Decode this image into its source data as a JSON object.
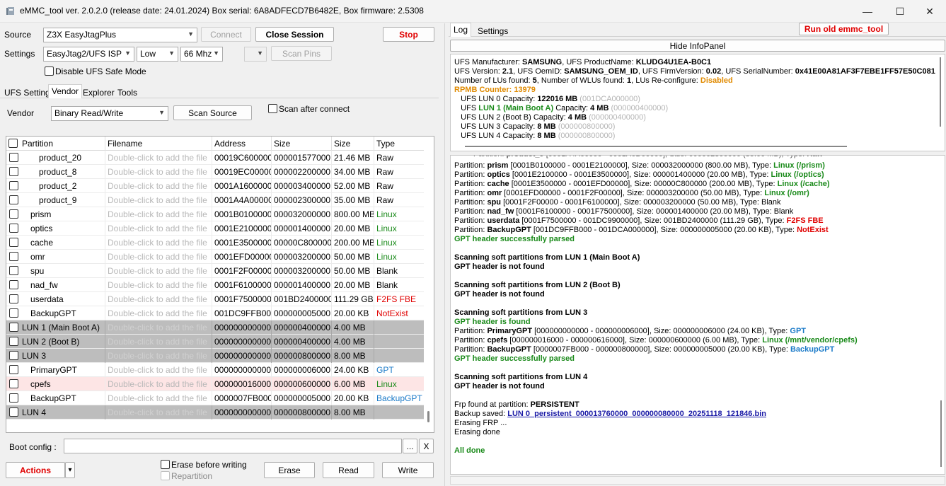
{
  "window": {
    "title": "eMMC_tool ver. 2.0.2.0 (release date: 24.01.2024) Box serial: 6A8ADFECD7B6482E, Box firmware: 2.5308",
    "minimize": "—",
    "maximize": "☐",
    "close": "✕"
  },
  "source": {
    "label": "Source",
    "value": "Z3X EasyJtagPlus",
    "connect": "Connect",
    "close_session": "Close Session",
    "stop": "Stop"
  },
  "settings": {
    "label": "Settings",
    "interface": "EasyJtag2/UFS ISP",
    "level": "Low",
    "speed": "66 Mhz",
    "extra": "",
    "scan_pins": "Scan Pins",
    "disable_safe_mode": "Disable UFS Safe Mode"
  },
  "left_tabs": [
    "UFS Settings",
    "Vendor",
    "Explorer",
    "Tools"
  ],
  "vendor": {
    "label": "Vendor",
    "value": "Binary Read/Write",
    "scan_source": "Scan Source",
    "scan_after_connect": "Scan after connect"
  },
  "table": {
    "headers": [
      "Partition",
      "Filename",
      "Address",
      "Size",
      "Size",
      "Type"
    ],
    "rows": [
      {
        "partition": "product_20",
        "filename": "Double-click to add the file",
        "address": "00019C600000",
        "size_hex": "000001577000",
        "size": "21.46 MB",
        "type": "Raw",
        "kind": "part",
        "indent": 2,
        "tcolor": "#000000"
      },
      {
        "partition": "product_8",
        "filename": "Double-click to add the file",
        "address": "00019EC00000",
        "size_hex": "000002200000",
        "size": "34.00 MB",
        "type": "Raw",
        "kind": "part",
        "indent": 2,
        "tcolor": "#000000"
      },
      {
        "partition": "product_2",
        "filename": "Double-click to add the file",
        "address": "0001A1600000",
        "size_hex": "000003400000",
        "size": "52.00 MB",
        "type": "Raw",
        "kind": "part",
        "indent": 2,
        "tcolor": "#000000"
      },
      {
        "partition": "product_9",
        "filename": "Double-click to add the file",
        "address": "0001A4A00000",
        "size_hex": "000002300000",
        "size": "35.00 MB",
        "type": "Raw",
        "kind": "part",
        "indent": 2,
        "tcolor": "#000000"
      },
      {
        "partition": "prism",
        "filename": "Double-click to add the file",
        "address": "0001B0100000",
        "size_hex": "000032000000",
        "size": "800.00 MB",
        "type": "Linux",
        "kind": "part",
        "indent": 1,
        "tcolor": "#1a8a1a"
      },
      {
        "partition": "optics",
        "filename": "Double-click to add the file",
        "address": "0001E2100000",
        "size_hex": "000001400000",
        "size": "20.00 MB",
        "type": "Linux",
        "kind": "part",
        "indent": 1,
        "tcolor": "#1a8a1a"
      },
      {
        "partition": "cache",
        "filename": "Double-click to add the file",
        "address": "0001E3500000",
        "size_hex": "00000C800000",
        "size": "200.00 MB",
        "type": "Linux",
        "kind": "part",
        "indent": 1,
        "tcolor": "#1a8a1a"
      },
      {
        "partition": "omr",
        "filename": "Double-click to add the file",
        "address": "0001EFD00000",
        "size_hex": "000003200000",
        "size": "50.00 MB",
        "type": "Linux",
        "kind": "part",
        "indent": 1,
        "tcolor": "#1a8a1a"
      },
      {
        "partition": "spu",
        "filename": "Double-click to add the file",
        "address": "0001F2F00000",
        "size_hex": "000003200000",
        "size": "50.00 MB",
        "type": "Blank",
        "kind": "part",
        "indent": 1,
        "tcolor": "#000000"
      },
      {
        "partition": "nad_fw",
        "filename": "Double-click to add the file",
        "address": "0001F6100000",
        "size_hex": "000001400000",
        "size": "20.00 MB",
        "type": "Blank",
        "kind": "part",
        "indent": 1,
        "tcolor": "#000000"
      },
      {
        "partition": "userdata",
        "filename": "Double-click to add the file",
        "address": "0001F7500000",
        "size_hex": "001BD2400000",
        "size": "111.29 GB",
        "type": "F2FS FBE",
        "kind": "part",
        "indent": 1,
        "tcolor": "#e00000"
      },
      {
        "partition": "BackupGPT",
        "filename": "Double-click to add the file",
        "address": "001DC9FFB000",
        "size_hex": "000000005000",
        "size": "20.00 KB",
        "type": "NotExist",
        "kind": "part",
        "indent": 1,
        "tcolor": "#e00000"
      },
      {
        "partition": "LUN 1 (Main Boot A)",
        "filename": "Double-click to add the file",
        "address": "000000000000",
        "size_hex": "000000400000",
        "size": "4.00 MB",
        "type": "",
        "kind": "lun",
        "indent": 0,
        "tcolor": "#000000"
      },
      {
        "partition": "LUN 2 (Boot B)",
        "filename": "Double-click to add the file",
        "address": "000000000000",
        "size_hex": "000000400000",
        "size": "4.00 MB",
        "type": "",
        "kind": "lun",
        "indent": 0,
        "tcolor": "#000000"
      },
      {
        "partition": "LUN 3",
        "filename": "Double-click to add the file",
        "address": "000000000000",
        "size_hex": "000000800000",
        "size": "8.00 MB",
        "type": "",
        "kind": "lun",
        "indent": 0,
        "tcolor": "#000000"
      },
      {
        "partition": "PrimaryGPT",
        "filename": "Double-click to add the file",
        "address": "000000000000",
        "size_hex": "000000006000",
        "size": "24.00 KB",
        "type": "GPT",
        "kind": "part",
        "indent": 1,
        "tcolor": "#1a7ac8"
      },
      {
        "partition": "cpefs",
        "filename": "Double-click to add the file",
        "address": "000000016000",
        "size_hex": "000000600000",
        "size": "6.00 MB",
        "type": "Linux",
        "kind": "pink",
        "indent": 1,
        "tcolor": "#1a8a1a"
      },
      {
        "partition": "BackupGPT",
        "filename": "Double-click to add the file",
        "address": "0000007FB000",
        "size_hex": "000000005000",
        "size": "20.00 KB",
        "type": "BackupGPT",
        "kind": "part",
        "indent": 1,
        "tcolor": "#1a7ac8"
      },
      {
        "partition": "LUN 4",
        "filename": "Double-click to add the file",
        "address": "000000000000",
        "size_hex": "000000800000",
        "size": "8.00 MB",
        "type": "",
        "kind": "lun",
        "indent": 0,
        "tcolor": "#000000"
      }
    ]
  },
  "bottom": {
    "boot_config_label": "Boot config :",
    "boot_config_value": "",
    "browse": "...",
    "clear": "X",
    "actions": "Actions",
    "actions_arrow": "▾",
    "erase_before_writing": "Erase before writing",
    "repartition": "Repartition",
    "erase": "Erase",
    "read": "Read",
    "write": "Write"
  },
  "right_tabs": [
    "Log",
    "Settings"
  ],
  "run_old": "Run old emmc_tool",
  "hide_infopanel": "Hide InfoPanel",
  "info_lines": [
    [
      {
        "t": "UFS Manufacturer: "
      },
      {
        "t": "SAMSUNG",
        "c": "b"
      },
      {
        "t": ", UFS ProductName: "
      },
      {
        "t": "KLUDG4U1EA-B0C1",
        "c": "b"
      }
    ],
    [
      {
        "t": "UFS Version: "
      },
      {
        "t": "2.1",
        "c": "b"
      },
      {
        "t": ", UFS OemID: "
      },
      {
        "t": "SAMSUNG_OEM_ID",
        "c": "b"
      },
      {
        "t": ", UFS FirmVersion: "
      },
      {
        "t": "0.02",
        "c": "b"
      },
      {
        "t": ", UFS SerialNumber: "
      },
      {
        "t": "0x41E00A81AF3F7EBE1FF57E50C081",
        "c": "b"
      }
    ],
    [
      {
        "t": "Number of LUs found: "
      },
      {
        "t": "5",
        "c": "b"
      },
      {
        "t": ", Number of WLUs found: "
      },
      {
        "t": "1",
        "c": "b"
      },
      {
        "t": ", LUs Re-configure: "
      },
      {
        "t": "Disabled",
        "c": "orange"
      }
    ],
    [
      {
        "t": "RPMB Counter: 13979",
        "c": "orange"
      }
    ],
    [
      {
        "t": "   UFS LUN 0 Capacity: "
      },
      {
        "t": "122016 MB",
        "c": "b"
      },
      {
        "t": " (001DCA000000)",
        "c": "gray"
      }
    ],
    [
      {
        "t": "   UFS "
      },
      {
        "t": "LUN 1 (Main Boot A)",
        "c": "green"
      },
      {
        "t": " Capacity: "
      },
      {
        "t": "4 MB",
        "c": "b"
      },
      {
        "t": " (000000400000)",
        "c": "gray"
      }
    ],
    [
      {
        "t": "   UFS LUN 2 (Boot B) Capacity: "
      },
      {
        "t": "4 MB",
        "c": "b"
      },
      {
        "t": " (000000400000)",
        "c": "gray"
      }
    ],
    [
      {
        "t": "   UFS LUN 3 Capacity: "
      },
      {
        "t": "8 MB",
        "c": "b"
      },
      {
        "t": " (000000800000)",
        "c": "gray"
      }
    ],
    [
      {
        "t": "   UFS LUN 4 Capacity: "
      },
      {
        "t": "8 MB",
        "c": "b"
      },
      {
        "t": " (000000800000)",
        "c": "gray"
      }
    ]
  ],
  "log_lines": [
    [
      {
        "t": "Partition: "
      },
      {
        "t": "prism",
        "c": "b"
      },
      {
        "t": " [0001B0100000 - 0001E2100000], Size: 000032000000 (800.00 MB), Type: "
      },
      {
        "t": "Linux (/prism)",
        "c": "green"
      }
    ],
    [
      {
        "t": "Partition: "
      },
      {
        "t": "optics",
        "c": "b"
      },
      {
        "t": " [0001E2100000 - 0001E3500000], Size: 000001400000 (20.00 MB), Type: "
      },
      {
        "t": "Linux (/optics)",
        "c": "green"
      }
    ],
    [
      {
        "t": "Partition: "
      },
      {
        "t": "cache",
        "c": "b"
      },
      {
        "t": " [0001E3500000 - 0001EFD00000], Size: 00000C800000 (200.00 MB), Type: "
      },
      {
        "t": "Linux (/cache)",
        "c": "green"
      }
    ],
    [
      {
        "t": "Partition: "
      },
      {
        "t": "omr",
        "c": "b"
      },
      {
        "t": " [0001EFD00000 - 0001F2F00000], Size: 000003200000 (50.00 MB), Type: "
      },
      {
        "t": "Linux (/omr)",
        "c": "green"
      }
    ],
    [
      {
        "t": "Partition: "
      },
      {
        "t": "spu",
        "c": "b"
      },
      {
        "t": " [0001F2F00000 - 0001F6100000], Size: 000003200000 (50.00 MB), Type: Blank"
      }
    ],
    [
      {
        "t": "Partition: "
      },
      {
        "t": "nad_fw",
        "c": "b"
      },
      {
        "t": " [0001F6100000 - 0001F7500000], Size: 000001400000 (20.00 MB), Type: Blank"
      }
    ],
    [
      {
        "t": "Partition: "
      },
      {
        "t": "userdata",
        "c": "b"
      },
      {
        "t": " [0001F7500000 - 001DC9900000], Size: 001BD2400000 (111.29 GB), Type: "
      },
      {
        "t": "F2FS FBE",
        "c": "red"
      }
    ],
    [
      {
        "t": "Partition: "
      },
      {
        "t": "BackupGPT",
        "c": "b"
      },
      {
        "t": " [001DC9FFB000 - 001DCA000000], Size: 000000005000 (20.00 KB), Type: "
      },
      {
        "t": "NotExist",
        "c": "red"
      }
    ],
    [
      {
        "t": "GPT header successfully parsed",
        "c": "green"
      }
    ],
    [],
    [
      {
        "t": "Scanning soft partitions from LUN 1 (Main Boot A)",
        "c": "b"
      }
    ],
    [
      {
        "t": "GPT header is not found",
        "c": "b"
      }
    ],
    [],
    [
      {
        "t": "Scanning soft partitions from LUN 2 (Boot B)",
        "c": "b"
      }
    ],
    [
      {
        "t": "GPT header is not found",
        "c": "b"
      }
    ],
    [],
    [
      {
        "t": "Scanning soft partitions from LUN 3",
        "c": "b"
      }
    ],
    [
      {
        "t": "GPT header is found",
        "c": "green"
      }
    ],
    [
      {
        "t": "Partition: "
      },
      {
        "t": "PrimaryGPT",
        "c": "b"
      },
      {
        "t": " [000000000000 - 000000006000], Size: 000000006000 (24.00 KB), Type: "
      },
      {
        "t": "GPT",
        "c": "blue"
      }
    ],
    [
      {
        "t": "Partition: "
      },
      {
        "t": "cpefs",
        "c": "b"
      },
      {
        "t": " [000000016000 - 000000616000], Size: 000000600000 (6.00 MB), Type: "
      },
      {
        "t": "Linux (/mnt/vendor/cpefs)",
        "c": "green"
      }
    ],
    [
      {
        "t": "Partition: "
      },
      {
        "t": "BackupGPT",
        "c": "b"
      },
      {
        "t": " [0000007FB000 - 000000800000], Size: 000000005000 (20.00 KB), Type: "
      },
      {
        "t": "BackupGPT",
        "c": "blue"
      }
    ],
    [
      {
        "t": "GPT header successfully parsed",
        "c": "green"
      }
    ],
    [],
    [
      {
        "t": "Scanning soft partitions from LUN 4",
        "c": "b"
      }
    ],
    [
      {
        "t": "GPT header is not found",
        "c": "b"
      }
    ],
    [],
    [
      {
        "t": "Frp found at partition: "
      },
      {
        "t": "PERSISTENT",
        "c": "b"
      }
    ],
    [
      {
        "t": "Backup saved: "
      },
      {
        "t": "LUN 0_persistent_000013760000_000000080000_20251118_121846.bin",
        "c": "link"
      }
    ],
    [
      {
        "t": "Erasing FRP ..."
      }
    ],
    [
      {
        "t": "Erasing done"
      }
    ],
    [],
    [
      {
        "t": "All done",
        "c": "green"
      }
    ]
  ]
}
